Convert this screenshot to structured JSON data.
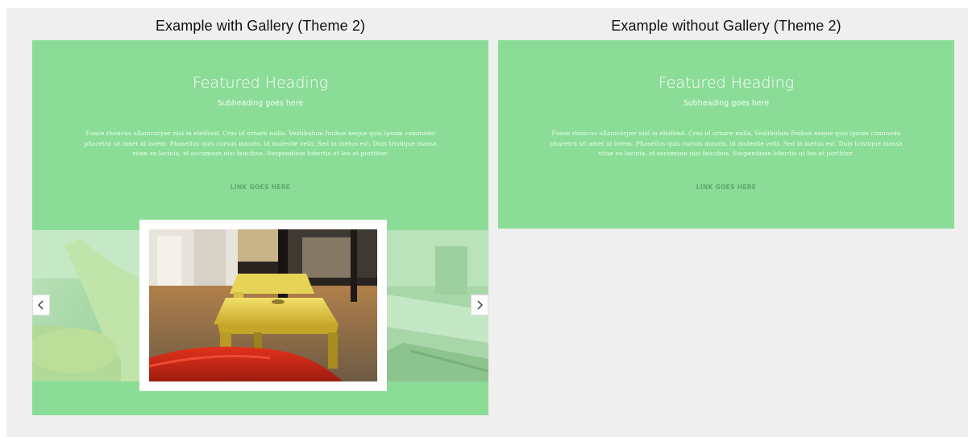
{
  "columns": {
    "left_title": "Example with Gallery (Theme 2)",
    "right_title": "Example without Gallery (Theme 2)"
  },
  "hero": {
    "heading": "Featured Heading",
    "subheading": "Subheading goes here",
    "body": "Fusce rhoncus ullamcorper nisl in eleifend. Cras id ornare nulla. Vestibulum finibus neque quis ipsum commodo pharetra sit amet id lorem. Phasellus quis cursus mauris, id molestie velit. Sed in metus est. Duis tristique massa vitae ex lacinia, id accumsan nisi faucibus. Suspendisse lobortis ut leo at porttitor.",
    "link": "LINK GOES HERE"
  },
  "gallery": {
    "prev_icon": "chevron-left-icon",
    "next_icon": "chevron-right-icon"
  },
  "colors": {
    "panel_bg": "#8bdc97",
    "page_bg": "#efefef",
    "link_text": "#5fa96a"
  }
}
